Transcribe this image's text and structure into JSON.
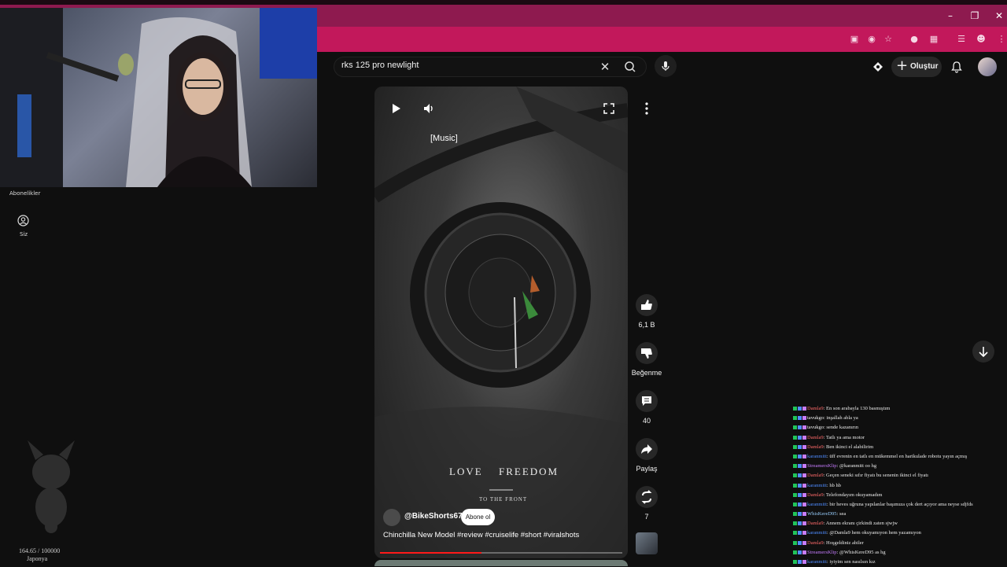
{
  "search": {
    "query": "rks 125 pro newlight"
  },
  "header": {
    "create_label": "Oluştur"
  },
  "sidebar": {
    "subscriptions_label": "Abonelikler",
    "you_label": "Siz"
  },
  "overlay_stats": {
    "count": "164.65 / 100000",
    "country": "Japonya"
  },
  "video": {
    "caption": "[Music]",
    "overlay_text_left": "LOVE",
    "overlay_text_right": "FREEDOM",
    "overlay_subtext": "TO THE FRONT",
    "channel": "@BikeShorts67",
    "subscribe_label": "Abone ol",
    "title": "Chinchilla New Model #review #cruiselife #short #viralshots",
    "progress_fraction": 0.42
  },
  "actions": {
    "like_count": "6,1 B",
    "dislike_label": "Beğenme",
    "comment_count": "40",
    "share_label": "Paylaş",
    "remix_count": "7"
  },
  "chat": [
    {
      "user": "Damla9",
      "color": "#ff6b6b",
      "message": "En son arabayla 130 basmıştım"
    },
    {
      "user": "tavukgo",
      "color": "#f2f2f2",
      "message": "inşallah abla ya"
    },
    {
      "user": "tavukgo",
      "color": "#f2f2f2",
      "message": "sende kazanırın"
    },
    {
      "user": "Damla9",
      "color": "#ff6b6b",
      "message": "Tatlı ya ama motor"
    },
    {
      "user": "Damla9",
      "color": "#ff6b6b",
      "message": "Ben ikinci el alabilirim"
    },
    {
      "user": "karanmitt",
      "color": "#4f8cff",
      "message": "üff evrenin en tatlı en mükemmel en harikulade robotu yayın açmış"
    },
    {
      "user": "StreamersKlip",
      "color": "#c77dff",
      "message": "@karanmitt oo hg"
    },
    {
      "user": "Damla9",
      "color": "#ff6b6b",
      "message": "Geçen seneki sıfır fiyatı bu senenin ikinci el fiyatı"
    },
    {
      "user": "karanmitt",
      "color": "#4f8cff",
      "message": "hb hb"
    },
    {
      "user": "Damla9",
      "color": "#ff6b6b",
      "message": "Telefondayım okuyamadım"
    },
    {
      "user": "karanmitt",
      "color": "#4f8cff",
      "message": "bir heves uğruna yapılanlar başımıza çok dert açıyor ama neyse sdjfds"
    },
    {
      "user": "WhisKereD95",
      "color": "#9ad0ff",
      "message": "sea"
    },
    {
      "user": "Damla9",
      "color": "#ff6b6b",
      "message": "Annem ekranı çirkindi zaten sjwjw"
    },
    {
      "user": "karanmitt",
      "color": "#4f8cff",
      "message": "@Damla9 hem okuyamıyon hem yazamıyon"
    },
    {
      "user": "Damla9",
      "color": "#ff6b6b",
      "message": "Hoşgeldiniz abiler"
    },
    {
      "user": "StreamersKlip",
      "color": "#c77dff",
      "message": "@WhisKereD95 as hg"
    },
    {
      "user": "karanmitt",
      "color": "#4f8cff",
      "message": "iyiyim sen nasılsın kız"
    }
  ]
}
